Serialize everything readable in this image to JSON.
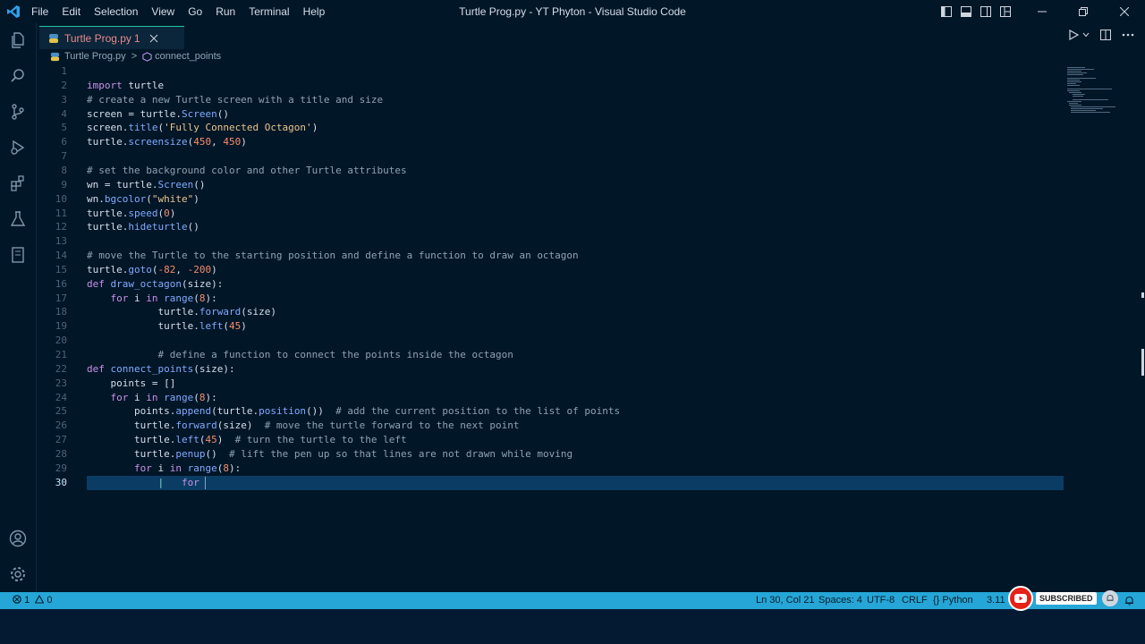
{
  "titlebar": {
    "menu": [
      "File",
      "Edit",
      "Selection",
      "View",
      "Go",
      "Run",
      "Terminal",
      "Help"
    ],
    "window_title": "Turtle Prog.py - YT Phyton - Visual Studio Code"
  },
  "tab": {
    "label": "Turtle Prog.py",
    "problem_count": "1"
  },
  "breadcrumb": {
    "file": "Turtle Prog.py",
    "separator": ">",
    "symbol": "connect_points"
  },
  "editor": {
    "active_line": 30,
    "lines": [
      {
        "n": "1",
        "tokens": []
      },
      {
        "n": "2",
        "tokens": [
          [
            "kw",
            "import"
          ],
          [
            "tx",
            " turtle"
          ]
        ]
      },
      {
        "n": "3",
        "tokens": [
          [
            "cm",
            "# create a new Turtle screen with a title and size"
          ]
        ]
      },
      {
        "n": "4",
        "tokens": [
          [
            "tx",
            "screen = turtle."
          ],
          [
            "fn",
            "Screen"
          ],
          [
            "tx",
            "()"
          ]
        ]
      },
      {
        "n": "5",
        "tokens": [
          [
            "tx",
            "screen."
          ],
          [
            "fn",
            "title"
          ],
          [
            "tx",
            "("
          ],
          [
            "str",
            "'Fully Connected Octagon'"
          ],
          [
            "tx",
            ")"
          ]
        ]
      },
      {
        "n": "6",
        "tokens": [
          [
            "tx",
            "turtle."
          ],
          [
            "fn",
            "screensize"
          ],
          [
            "tx",
            "("
          ],
          [
            "num",
            "450"
          ],
          [
            "tx",
            ", "
          ],
          [
            "num",
            "450"
          ],
          [
            "tx",
            ")"
          ]
        ]
      },
      {
        "n": "7",
        "tokens": []
      },
      {
        "n": "8",
        "tokens": [
          [
            "cm",
            "# set the background color and other Turtle attributes"
          ]
        ]
      },
      {
        "n": "9",
        "tokens": [
          [
            "tx",
            "wn = turtle."
          ],
          [
            "fn",
            "Screen"
          ],
          [
            "tx",
            "()"
          ]
        ]
      },
      {
        "n": "10",
        "tokens": [
          [
            "tx",
            "wn."
          ],
          [
            "fn",
            "bgcolor"
          ],
          [
            "tx",
            "("
          ],
          [
            "str",
            "\"white\""
          ],
          [
            "tx",
            ")"
          ]
        ]
      },
      {
        "n": "11",
        "tokens": [
          [
            "tx",
            "turtle."
          ],
          [
            "fn",
            "speed"
          ],
          [
            "tx",
            "("
          ],
          [
            "num",
            "0"
          ],
          [
            "tx",
            ")"
          ]
        ]
      },
      {
        "n": "12",
        "tokens": [
          [
            "tx",
            "turtle."
          ],
          [
            "fn",
            "hideturtle"
          ],
          [
            "tx",
            "()"
          ]
        ]
      },
      {
        "n": "13",
        "tokens": []
      },
      {
        "n": "14",
        "tokens": [
          [
            "cm",
            "# move the Turtle to the starting position and define a function to draw an octagon"
          ]
        ]
      },
      {
        "n": "15",
        "tokens": [
          [
            "tx",
            "turtle."
          ],
          [
            "fn",
            "goto"
          ],
          [
            "tx",
            "("
          ],
          [
            "num",
            "-82"
          ],
          [
            "tx",
            ", "
          ],
          [
            "num",
            "-200"
          ],
          [
            "tx",
            ")"
          ]
        ]
      },
      {
        "n": "16",
        "tokens": [
          [
            "kw",
            "def"
          ],
          [
            "tx",
            " "
          ],
          [
            "fn",
            "draw_octagon"
          ],
          [
            "tx",
            "(size):"
          ]
        ]
      },
      {
        "n": "17",
        "tokens": [
          [
            "tx",
            "    "
          ],
          [
            "kw",
            "for"
          ],
          [
            "tx",
            " i "
          ],
          [
            "kw",
            "in"
          ],
          [
            "tx",
            " "
          ],
          [
            "fn",
            "range"
          ],
          [
            "tx",
            "("
          ],
          [
            "num",
            "8"
          ],
          [
            "tx",
            "):"
          ]
        ]
      },
      {
        "n": "18",
        "tokens": [
          [
            "tx",
            "            turtle."
          ],
          [
            "fn",
            "forward"
          ],
          [
            "tx",
            "(size)"
          ]
        ]
      },
      {
        "n": "19",
        "tokens": [
          [
            "tx",
            "            turtle."
          ],
          [
            "fn",
            "left"
          ],
          [
            "tx",
            "("
          ],
          [
            "num",
            "45"
          ],
          [
            "tx",
            ")"
          ]
        ]
      },
      {
        "n": "20",
        "tokens": []
      },
      {
        "n": "21",
        "tokens": [
          [
            "tx",
            "            "
          ],
          [
            "cm",
            "# define a function to connect the points inside the octagon"
          ]
        ]
      },
      {
        "n": "22",
        "tokens": [
          [
            "kw",
            "def"
          ],
          [
            "tx",
            " "
          ],
          [
            "fn",
            "connect_points"
          ],
          [
            "tx",
            "(size):"
          ]
        ]
      },
      {
        "n": "23",
        "tokens": [
          [
            "tx",
            "    points = []"
          ]
        ]
      },
      {
        "n": "24",
        "tokens": [
          [
            "tx",
            "    "
          ],
          [
            "kw",
            "for"
          ],
          [
            "tx",
            " i "
          ],
          [
            "kw",
            "in"
          ],
          [
            "tx",
            " "
          ],
          [
            "fn",
            "range"
          ],
          [
            "tx",
            "("
          ],
          [
            "num",
            "8"
          ],
          [
            "tx",
            "):"
          ]
        ]
      },
      {
        "n": "25",
        "tokens": [
          [
            "tx",
            "        points."
          ],
          [
            "fn",
            "append"
          ],
          [
            "tx",
            "(turtle."
          ],
          [
            "fn",
            "position"
          ],
          [
            "tx",
            "())  "
          ],
          [
            "cm",
            "# add the current position to the list of points"
          ]
        ]
      },
      {
        "n": "26",
        "tokens": [
          [
            "tx",
            "        turtle."
          ],
          [
            "fn",
            "forward"
          ],
          [
            "tx",
            "(size)  "
          ],
          [
            "cm",
            "# move the turtle forward to the next point"
          ]
        ]
      },
      {
        "n": "27",
        "tokens": [
          [
            "tx",
            "        turtle."
          ],
          [
            "fn",
            "left"
          ],
          [
            "tx",
            "("
          ],
          [
            "num",
            "45"
          ],
          [
            "tx",
            ")  "
          ],
          [
            "cm",
            "# turn the turtle to the left"
          ]
        ]
      },
      {
        "n": "28",
        "tokens": [
          [
            "tx",
            "        turtle."
          ],
          [
            "fn",
            "penup"
          ],
          [
            "tx",
            "()  "
          ],
          [
            "cm",
            "# lift the pen up so that lines are not drawn while moving"
          ]
        ]
      },
      {
        "n": "29",
        "tokens": [
          [
            "tx",
            "        "
          ],
          [
            "kw",
            "for"
          ],
          [
            "tx",
            " i "
          ],
          [
            "kw",
            "in"
          ],
          [
            "tx",
            " "
          ],
          [
            "fn",
            "range"
          ],
          [
            "tx",
            "("
          ],
          [
            "num",
            "8"
          ],
          [
            "tx",
            "):"
          ]
        ]
      },
      {
        "n": "30",
        "tokens": [
          [
            "tx",
            "            "
          ],
          [
            "pn",
            "|"
          ],
          [
            "tx",
            "   "
          ],
          [
            "kw",
            "for"
          ],
          [
            "tx",
            " "
          ]
        ]
      }
    ]
  },
  "statusbar": {
    "errors": "1",
    "warnings": "0",
    "position": "Ln 30, Col 21",
    "spaces": "Spaces: 4",
    "encoding": "UTF-8",
    "eol": "CRLF",
    "language": "Python",
    "version": "3.11"
  },
  "overlay": {
    "subscribe_label": "SUBSCRIBED"
  },
  "colors": {
    "accent": "#21c7a8",
    "statusbar": "#25a6d6",
    "background": "#011627"
  }
}
